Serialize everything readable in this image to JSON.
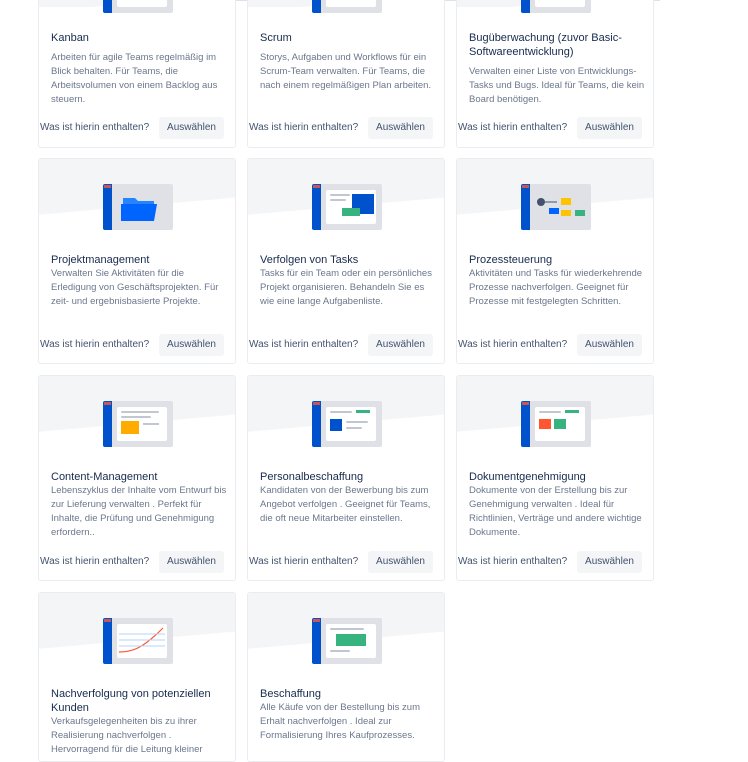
{
  "templates": [
    {
      "id": "kanban",
      "title": "Kanban",
      "description": "Arbeiten für agile Teams regelmäßig im Blick behalten. Für Teams, die Arbeitsvolumen von einem Backlog aus steuern.",
      "whats_in": "Was ist hierin enthalten?",
      "select_label": "Auswählen",
      "icon": "kanban-illustration"
    },
    {
      "id": "scrum",
      "title": "Scrum",
      "description": "Storys, Aufgaben und Workflows für ein Scrum-Team verwalten. Für Teams, die nach einem regelmäßigen Plan arbeiten.",
      "whats_in": "Was ist hierin enthalten?",
      "select_label": "Auswählen",
      "icon": "scrum-illustration"
    },
    {
      "id": "bug-tracking",
      "title": "Bugüberwachung (zuvor Basic-Softwareentwicklung)",
      "description": "Verwalten einer Liste von Entwicklungs-Tasks und Bugs. Ideal für Teams, die kein Board benötigen.",
      "whats_in": "Was ist hierin enthalten?",
      "select_label": "Auswählen",
      "icon": "bug-tracking-illustration"
    },
    {
      "id": "project-management",
      "title": "Projektmanagement",
      "description": "Verwalten Sie Aktivitäten für die Erledigung von Geschäftsprojekten. Für zeit- und ergebnisbasierte Projekte.",
      "whats_in": "Was ist hierin enthalten?",
      "select_label": "Auswählen",
      "icon": "folder-illustration"
    },
    {
      "id": "task-tracking",
      "title": "Verfolgen von Tasks",
      "description": "Tasks für ein Team oder ein persönliches Projekt organisieren. Behandeln Sie es wie eine lange Aufgabenliste.",
      "whats_in": "Was ist hierin enthalten?",
      "select_label": "Auswählen",
      "icon": "task-illustration"
    },
    {
      "id": "process-control",
      "title": "Prozessteuerung",
      "description": "Aktivitäten und Tasks für wiederkehrende Prozesse nachverfolgen. Geeignet für Prozesse mit festgelegten Schritten.",
      "whats_in": "Was ist hierin enthalten?",
      "select_label": "Auswählen",
      "icon": "process-illustration"
    },
    {
      "id": "content-management",
      "title": "Content-Management",
      "description": "Lebenszyklus der Inhalte vom Entwurf bis zur Lieferung verwalten . Perfekt für Inhalte, die Prüfung und Genehmigung erfordern..",
      "whats_in": "Was ist hierin enthalten?",
      "select_label": "Auswählen",
      "icon": "content-illustration"
    },
    {
      "id": "recruiting",
      "title": "Personalbeschaffung",
      "description": "Kandidaten von der Bewerbung bis zum Angebot verfolgen . Geeignet für Teams, die oft neue Mitarbeiter einstellen.",
      "whats_in": "Was ist hierin enthalten?",
      "select_label": "Auswählen",
      "icon": "recruiting-illustration"
    },
    {
      "id": "document-approval",
      "title": "Dokumentgenehmigung",
      "description": "Dokumente von der Erstellung bis zur Genehmigung verwalten . Ideal für Richtlinien, Verträge und andere wichtige Dokumente.",
      "whats_in": "Was ist hierin enthalten?",
      "select_label": "Auswählen",
      "icon": "document-illustration"
    },
    {
      "id": "lead-tracking",
      "title": "Nachverfolgung von potenziellen Kunden",
      "description": "Verkaufsgelegenheiten bis zu ihrer Realisierung nachverfolgen . Hervorragend für die Leitung kleiner",
      "whats_in": "",
      "select_label": "",
      "icon": "chart-illustration"
    },
    {
      "id": "procurement",
      "title": "Beschaffung",
      "description": "Alle Käufe von der Bestellung bis zum Erhalt nachverfolgen . Ideal zur Formalisierung Ihres Kaufprozesses.",
      "whats_in": "",
      "select_label": "",
      "icon": "procurement-illustration"
    }
  ],
  "colors": {
    "accent": "#0052cc",
    "text": "#172b4d",
    "muted": "#6b778c",
    "button_bg": "#f4f5f7"
  }
}
